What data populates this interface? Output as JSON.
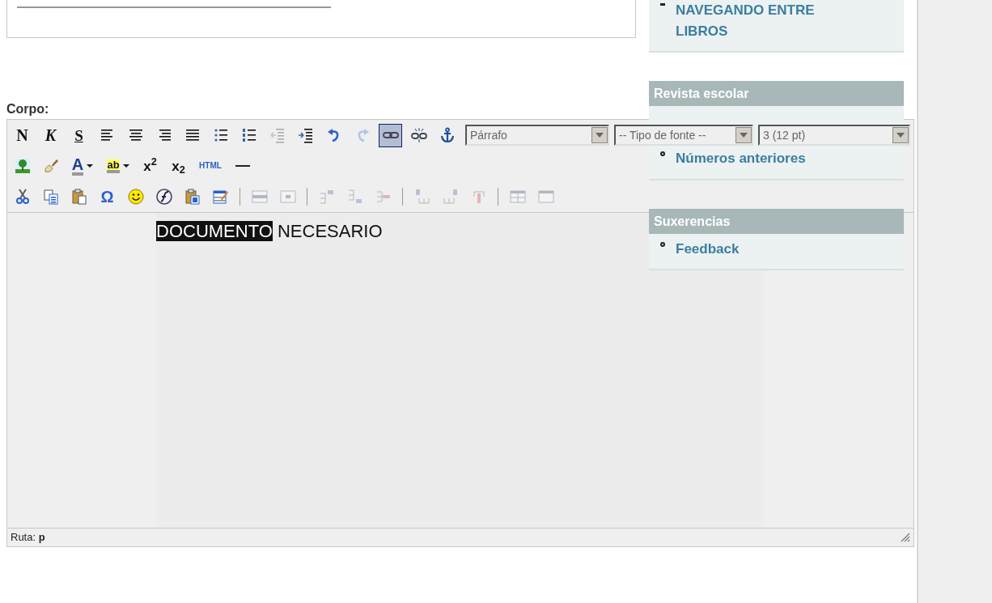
{
  "editor": {
    "label": "Corpo:",
    "toolbar_rows": [
      {
        "groups": [
          [
            {
              "kind": "bold",
              "label": "N",
              "active": false,
              "disabled": false
            },
            {
              "kind": "italic",
              "label": "K",
              "active": false,
              "disabled": false
            },
            {
              "kind": "strike",
              "label": "S",
              "active": false,
              "disabled": false
            },
            {
              "kind": "align-left",
              "active": false,
              "disabled": false
            },
            {
              "kind": "align-center",
              "active": false,
              "disabled": false
            },
            {
              "kind": "align-right",
              "active": false,
              "disabled": false
            },
            {
              "kind": "justify",
              "active": false,
              "disabled": false
            },
            {
              "kind": "bullet-list",
              "active": false,
              "disabled": false
            },
            {
              "kind": "number-list",
              "active": false,
              "disabled": false
            },
            {
              "kind": "outdent",
              "active": false,
              "disabled": true
            },
            {
              "kind": "indent",
              "active": false,
              "disabled": false
            },
            {
              "kind": "undo",
              "active": false,
              "disabled": false
            },
            {
              "kind": "redo",
              "active": false,
              "disabled": true
            },
            {
              "kind": "link",
              "active": true,
              "disabled": false
            },
            {
              "kind": "unlink",
              "active": false,
              "disabled": false
            },
            {
              "kind": "anchor",
              "active": false,
              "disabled": false
            }
          ]
        ],
        "selects": [
          {
            "value": "Párrafo"
          },
          {
            "value": "-- Tipo de fonte --"
          },
          {
            "value": "3 (12 pt)"
          }
        ]
      },
      {
        "groups": [
          [
            {
              "kind": "image",
              "active": false,
              "disabled": false
            },
            {
              "kind": "cleanup",
              "active": false,
              "disabled": false
            },
            {
              "kind": "font-color",
              "label": "A",
              "active": false,
              "disabled": false
            },
            {
              "kind": "highlight",
              "label": "ab",
              "active": false,
              "disabled": false
            },
            {
              "kind": "superscript",
              "label": "x$^{2}$",
              "active": false,
              "disabled": false
            },
            {
              "kind": "subscript",
              "label": "x$_{2}$",
              "active": false,
              "disabled": false
            },
            {
              "kind": "html",
              "label": "HTML",
              "active": false,
              "disabled": false
            },
            {
              "kind": "rule",
              "active": false,
              "disabled": false
            }
          ]
        ]
      },
      {
        "groups": [
          [
            {
              "kind": "cut",
              "active": false,
              "disabled": false
            },
            {
              "kind": "copy",
              "active": false,
              "disabled": false
            },
            {
              "kind": "paste",
              "active": false,
              "disabled": false
            },
            {
              "kind": "special-char",
              "label": "Ω",
              "active": false,
              "disabled": false
            },
            {
              "kind": "smiley",
              "active": false,
              "disabled": false
            },
            {
              "kind": "flash",
              "active": false,
              "disabled": false
            },
            {
              "kind": "paste-word",
              "active": false,
              "disabled": false
            },
            {
              "kind": "table",
              "active": false,
              "disabled": false
            }
          ],
          [
            {
              "kind": "row-props",
              "active": false,
              "disabled": true
            },
            {
              "kind": "cell-props",
              "active": false,
              "disabled": true
            }
          ],
          [
            {
              "kind": "row-before",
              "active": false,
              "disabled": true
            },
            {
              "kind": "row-after",
              "active": false,
              "disabled": true
            },
            {
              "kind": "row-delete",
              "active": false,
              "disabled": true
            }
          ],
          [
            {
              "kind": "col-before",
              "active": false,
              "disabled": true
            },
            {
              "kind": "col-after",
              "active": false,
              "disabled": true
            },
            {
              "kind": "col-delete",
              "active": false,
              "disabled": true
            }
          ],
          [
            {
              "kind": "split",
              "active": false,
              "disabled": true
            },
            {
              "kind": "merge",
              "active": false,
              "disabled": true
            }
          ]
        ]
      }
    ],
    "content": [
      {
        "text": "DOCUMENTO",
        "selected": true
      },
      {
        "text": " NECESARIO",
        "selected": false
      }
    ],
    "status_bar": "Ruta: **p**"
  },
  "sidebar": [
    {
      "items": [
        "NAVEGANDO ENTRE LIBROS"
      ]
    },
    {
      "title": "Revista escolar",
      "items": [
        "Números anteriores"
      ]
    },
    {
      "title": "Suxerencias",
      "items": [
        "Feedback"
      ]
    }
  ]
}
